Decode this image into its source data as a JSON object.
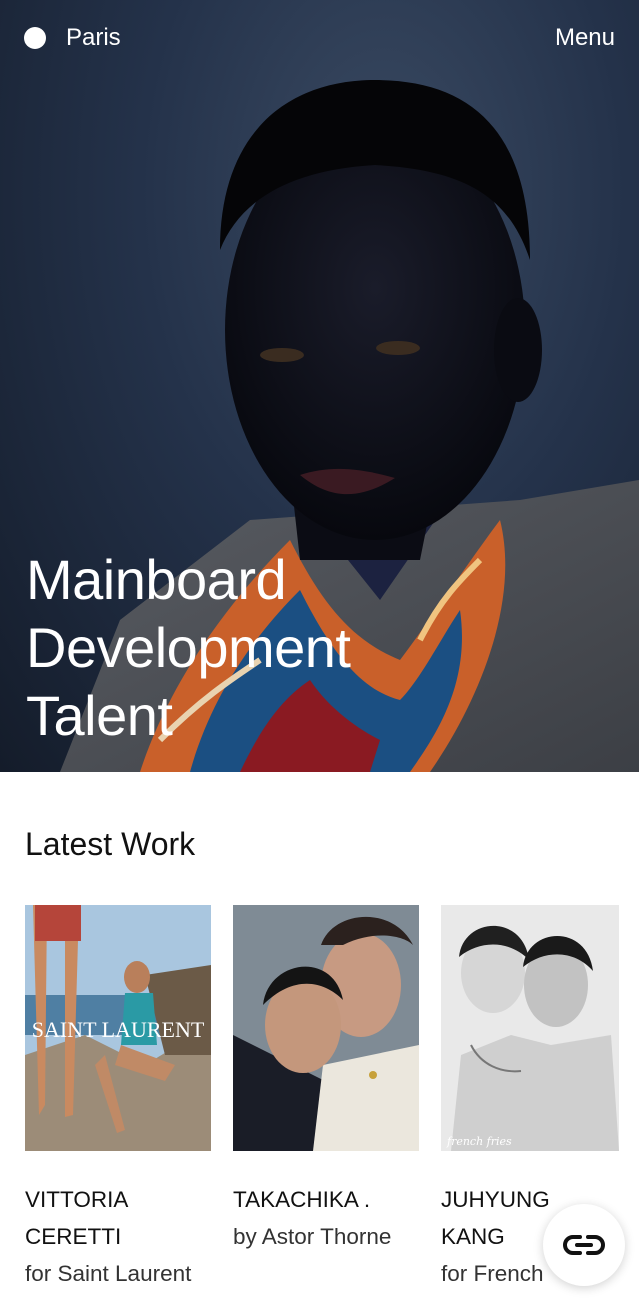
{
  "header": {
    "location": "Paris",
    "menu_label": "Menu"
  },
  "hero": {
    "title_lines": [
      "Mainboard",
      "Development",
      "Talent"
    ]
  },
  "latest": {
    "heading": "Latest Work",
    "items": [
      {
        "name_lines": [
          "VITTORIA",
          "CERETTI"
        ],
        "subtitle": "for Saint Laurent",
        "image_text": "SAINT LAURENT"
      },
      {
        "name_lines": [
          "TAKACHIKA ."
        ],
        "subtitle": "by Astor Thorne"
      },
      {
        "name_lines": [
          "JUHYUNG",
          "KANG"
        ],
        "subtitle": "for French",
        "image_text": "french fries"
      }
    ]
  },
  "icons": {
    "location_dot": "circle-dot-icon",
    "chat": "link-chain-icon"
  }
}
